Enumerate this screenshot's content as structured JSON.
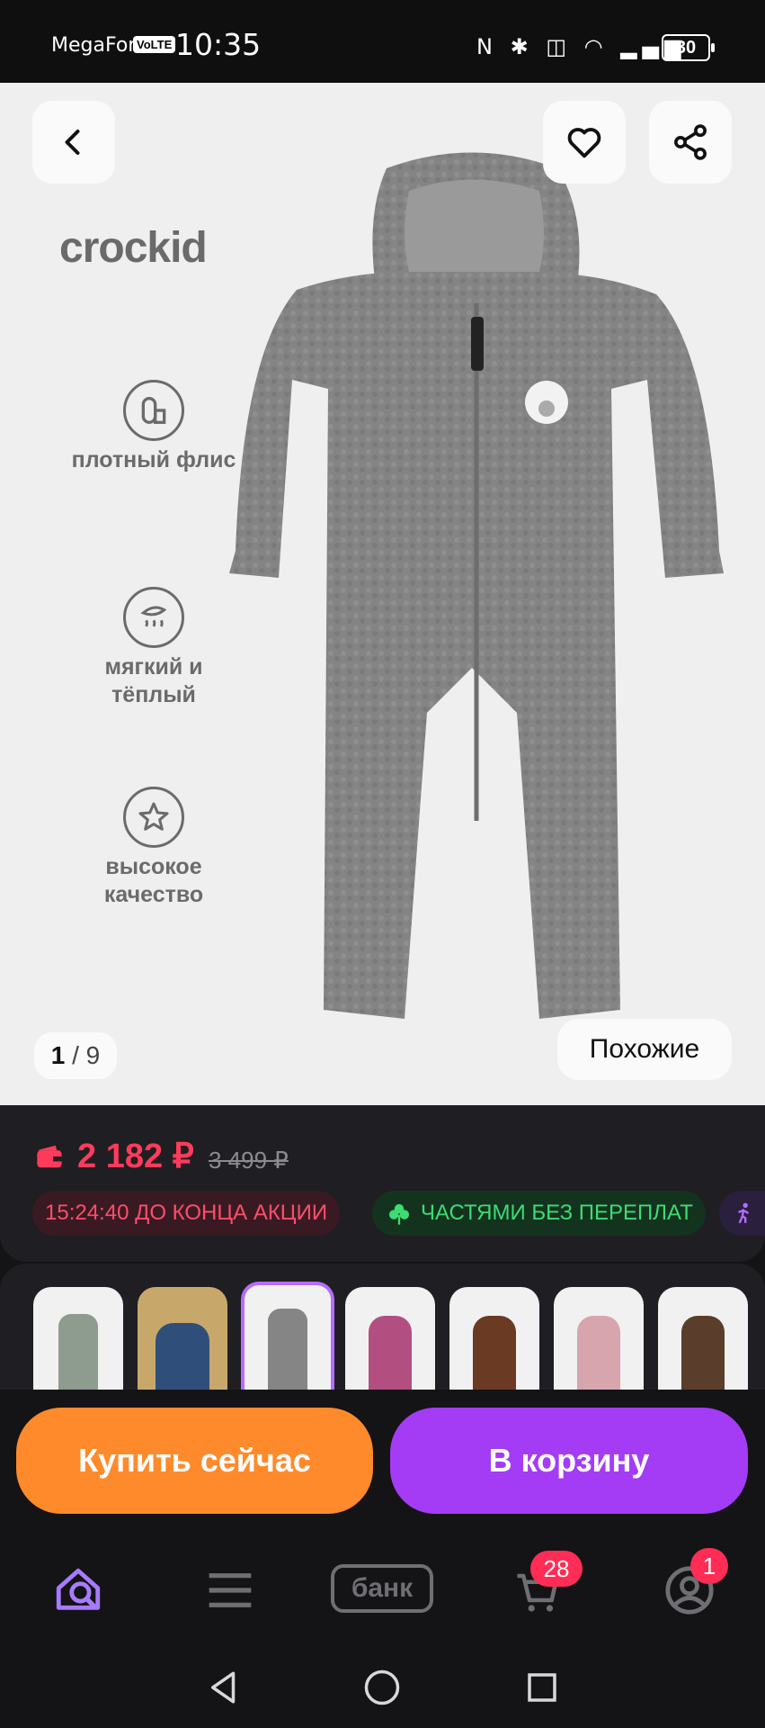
{
  "status_bar": {
    "carrier": "MegaFon",
    "volte": "VoLTE",
    "time": "10:35",
    "icons": "N ✱ ◫ ◠ ▂▄▆",
    "battery": "30"
  },
  "gallery": {
    "brand": "crockid",
    "features": [
      {
        "label": "плотный флис",
        "icon": "fleece-roll-icon"
      },
      {
        "label": "мягкий и тёплый",
        "icon": "feather-warm-icon"
      },
      {
        "label": "высокое качество",
        "icon": "star-quality-icon"
      }
    ],
    "counter_current": "1",
    "counter_total": "/ 9",
    "similar_label": "Похожие"
  },
  "price": {
    "current": "2 182 ₽",
    "old": "3 499 ₽",
    "timer_chip": "15:24:40 ДО КОНЦА АКЦИИ",
    "installment_chip": "ЧАСТЯМИ БЕЗ ПЕРЕПЛАТ"
  },
  "variants": [
    {
      "color": "#8e9b8f"
    },
    {
      "color": "#2f4f7a"
    },
    {
      "color": "#858585"
    },
    {
      "color": "#b24f80"
    },
    {
      "color": "#6b3a22"
    },
    {
      "color": "#d7a5ae"
    },
    {
      "color": "#5a3e2b"
    }
  ],
  "actions": {
    "buy_now": "Купить сейчас",
    "add_to_cart": "В корзину"
  },
  "bottom_nav": {
    "bank_label": "банк",
    "cart_badge": "28",
    "profile_badge": "1"
  },
  "colors": {
    "accent_orange": "#ff8a2b",
    "accent_purple": "#a43cf5",
    "price_red": "#ff3b5c"
  }
}
